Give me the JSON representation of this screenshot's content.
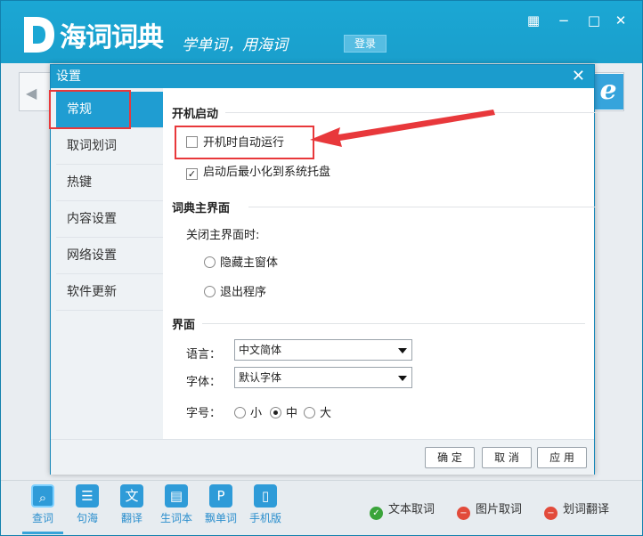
{
  "app": {
    "title": "海词词典",
    "slogan": "学单词，用海词",
    "login_label": "登录",
    "window_controls": [
      "skin-icon",
      "minimize-icon",
      "maximize-icon",
      "close-icon"
    ]
  },
  "dialog": {
    "title": "设置",
    "sidebar": {
      "items": [
        {
          "label": "常规",
          "active": true
        },
        {
          "label": "取词划词",
          "active": false
        },
        {
          "label": "热键",
          "active": false
        },
        {
          "label": "内容设置",
          "active": false
        },
        {
          "label": "网络设置",
          "active": false
        },
        {
          "label": "软件更新",
          "active": false
        }
      ]
    },
    "startup": {
      "title": "开机启动",
      "autorun_label": "开机时自动运行",
      "autorun_checked": false,
      "minimize_label": "启动后最小化到系统托盘",
      "minimize_checked": true
    },
    "main_window": {
      "title": "词典主界面",
      "close_label": "关闭主界面时:",
      "options": [
        {
          "label": "隐藏主窗体",
          "selected": false
        },
        {
          "label": "退出程序",
          "selected": false
        }
      ]
    },
    "ui": {
      "title": "界面",
      "language_label": "语言：",
      "language_value": "中文简体",
      "font_label": "字体：",
      "font_value": "默认字体",
      "size_label": "字号：",
      "size_options": [
        {
          "label": "小",
          "selected": false
        },
        {
          "label": "中",
          "selected": true
        },
        {
          "label": "大",
          "selected": false
        }
      ]
    },
    "buttons": {
      "ok": "确 定",
      "cancel": "取 消",
      "apply": "应 用"
    },
    "highlight_color": "#e8383b"
  },
  "bottom_bar": {
    "tools": [
      {
        "label": "查词",
        "icon": "search-icon",
        "active": true
      },
      {
        "label": "句海",
        "icon": "document-icon",
        "active": false
      },
      {
        "label": "翻译",
        "icon": "translate-icon",
        "active": false
      },
      {
        "label": "生词本",
        "icon": "notebook-icon",
        "active": false
      },
      {
        "label": "飘单词",
        "icon": "floating-word-icon",
        "active": false
      },
      {
        "label": "手机版",
        "icon": "phone-icon",
        "active": false
      }
    ],
    "status": [
      {
        "label": "文本取词",
        "state": "on",
        "color": "#3aa43a"
      },
      {
        "label": "图片取词",
        "state": "off",
        "color": "#e24b3b"
      },
      {
        "label": "划词翻译",
        "state": "off",
        "color": "#e24b3b"
      }
    ]
  }
}
